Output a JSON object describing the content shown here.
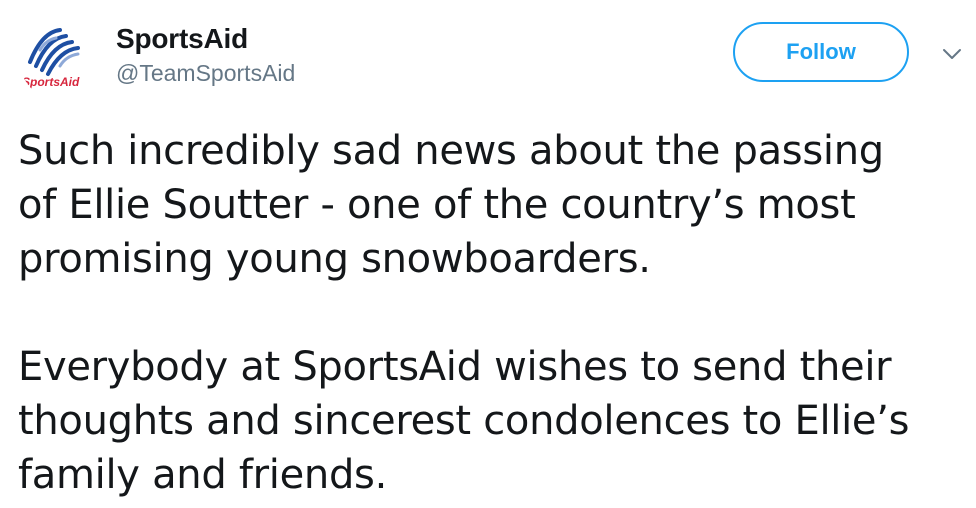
{
  "user": {
    "display_name": "SportsAid",
    "handle": "@TeamSportsAid",
    "logo_text": "SportsAid"
  },
  "actions": {
    "follow_label": "Follow",
    "caret_icon": "chevron-down-icon"
  },
  "tweet": {
    "paragraphs": [
      [
        "Such incredibly sad news about the passing",
        "of Ellie Soutter - one of the country’s most",
        "promising young snowboarders."
      ],
      [
        "Everybody at SportsAid wishes to send their",
        "thoughts and sincerest condolences to Ellie’s",
        "family and friends."
      ]
    ]
  },
  "colors": {
    "accent": "#1da1f2",
    "text": "#14171a",
    "secondary": "#657786",
    "logo_red": "#d7263d",
    "logo_blue": "#1e4fa3"
  }
}
